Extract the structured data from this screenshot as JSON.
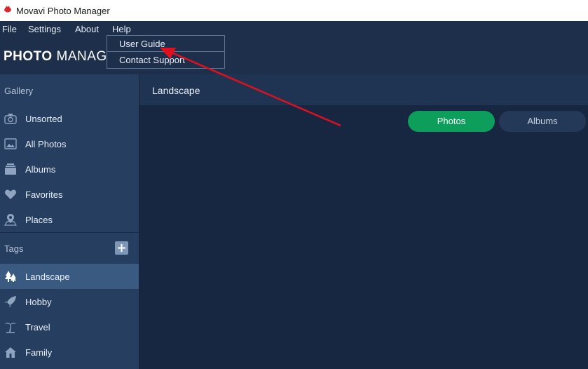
{
  "window": {
    "title": "Movavi Photo Manager"
  },
  "menu": {
    "file": "File",
    "settings": "Settings",
    "about": "About",
    "help": "Help"
  },
  "help_menu": {
    "items": [
      "User Guide",
      "Contact Support"
    ]
  },
  "header": {
    "logo_bold": "PHOTO",
    "logo_rest": " MANAGER"
  },
  "sidebar": {
    "gallery_label": "Gallery",
    "gallery_items": [
      {
        "label": "Unsorted",
        "icon": "camera-icon"
      },
      {
        "label": "All Photos",
        "icon": "photos-icon"
      },
      {
        "label": "Albums",
        "icon": "albums-icon"
      },
      {
        "label": "Favorites",
        "icon": "heart-icon"
      },
      {
        "label": "Places",
        "icon": "map-pin-icon"
      }
    ],
    "tags_label": "Tags",
    "tag_items": [
      {
        "label": "Landscape",
        "icon": "trees-icon",
        "active": true
      },
      {
        "label": "Hobby",
        "icon": "rocket-icon"
      },
      {
        "label": "Travel",
        "icon": "palm-tree-icon"
      },
      {
        "label": "Family",
        "icon": "house-icon"
      }
    ]
  },
  "main": {
    "title": "Landscape",
    "toggle": {
      "photos": "Photos",
      "albums": "Albums",
      "selected": "Photos"
    }
  },
  "colors": {
    "accent_green": "#0d9e5c",
    "annotation_red": "#e0101e",
    "sidebar_bg": "#263e5f",
    "active_item": "#3b5a82"
  }
}
